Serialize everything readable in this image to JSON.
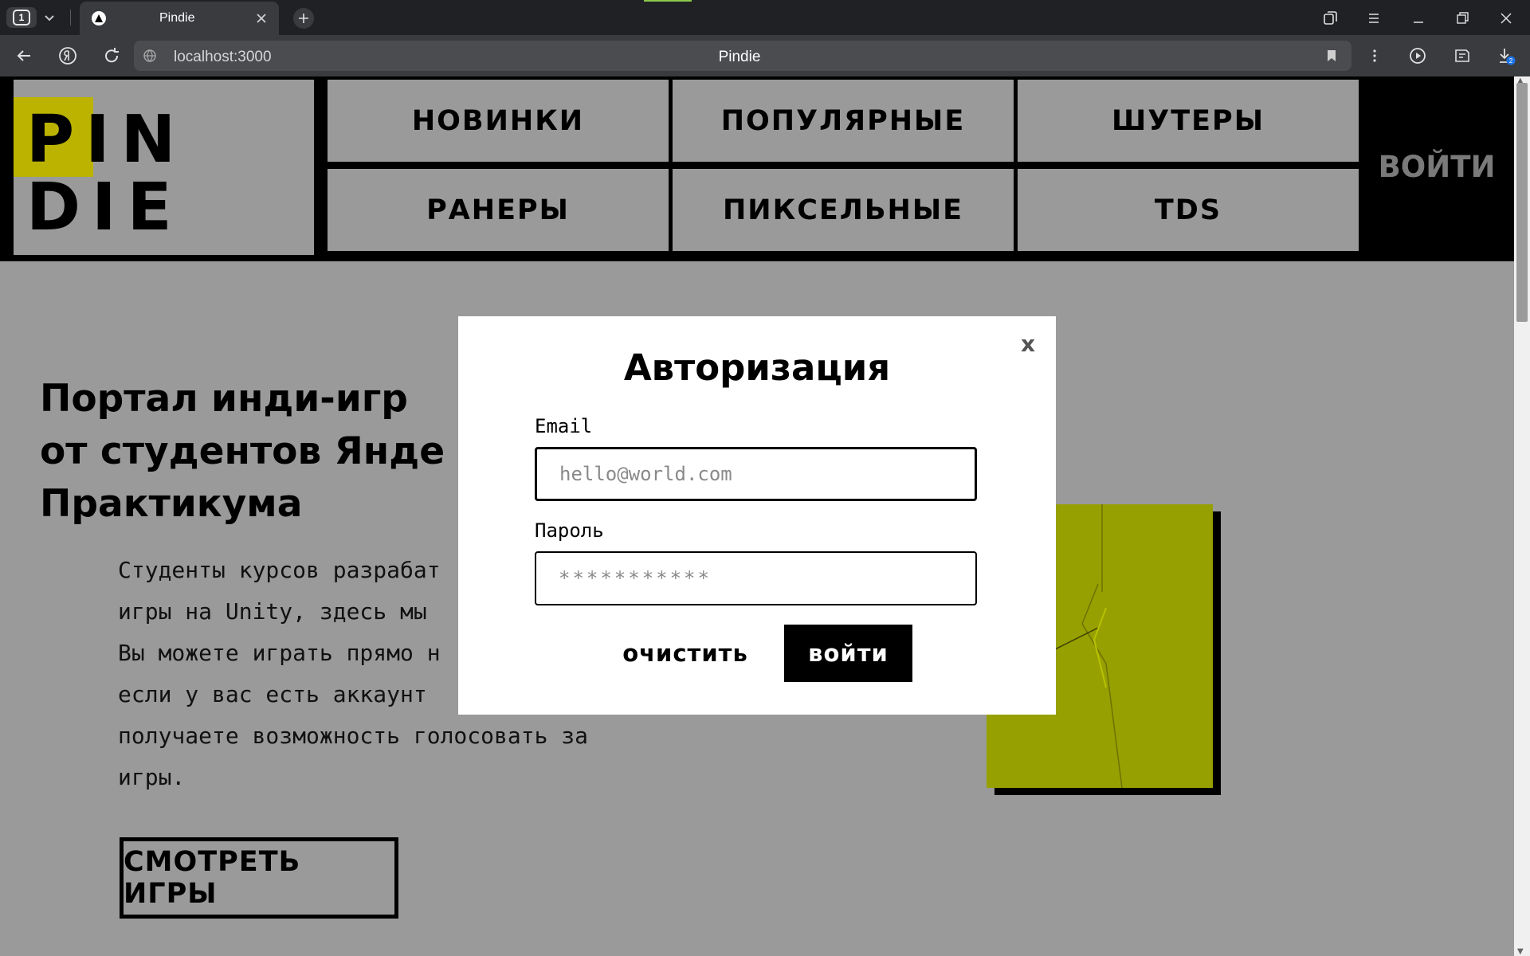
{
  "browser": {
    "tab_count": "1",
    "tab_title": "Pindie",
    "url": "localhost:3000",
    "page_title": "Pindie",
    "download_badge": "2"
  },
  "site": {
    "logo_line1": "PIN",
    "logo_line2": "DIE",
    "nav": {
      "items": [
        {
          "label": "НОВИНКИ"
        },
        {
          "label": "ПОПУЛЯРНЫЕ"
        },
        {
          "label": "ШУТЕРЫ"
        },
        {
          "label": "РАНЕРЫ"
        },
        {
          "label": "ПИКСЕЛЬНЫЕ"
        },
        {
          "label": "TDS"
        }
      ],
      "login_label": "ВОЙТИ"
    },
    "hero": {
      "title_line1": "Портал инди-игр",
      "title_line2": "от студентов Янде",
      "title_line3": "Практикума",
      "text_lines": [
        "Студенты курсов разрабат",
        "игры на Unity, здесь мы ",
        "Вы можете играть прямо н",
        "если у вас есть аккаунт ",
        "получаете возможность голосовать за",
        "игры."
      ],
      "cta_label": "СМОТРЕТЬ ИГРЫ"
    },
    "accent_color": "#bcb300"
  },
  "modal": {
    "close_label": "x",
    "title": "Авторизация",
    "email_label": "Email",
    "email_placeholder": "hello@world.com",
    "email_value": "",
    "password_label": "Пароль",
    "password_placeholder": "***********",
    "password_value": "",
    "clear_label": "очистить",
    "submit_label": "войти"
  }
}
